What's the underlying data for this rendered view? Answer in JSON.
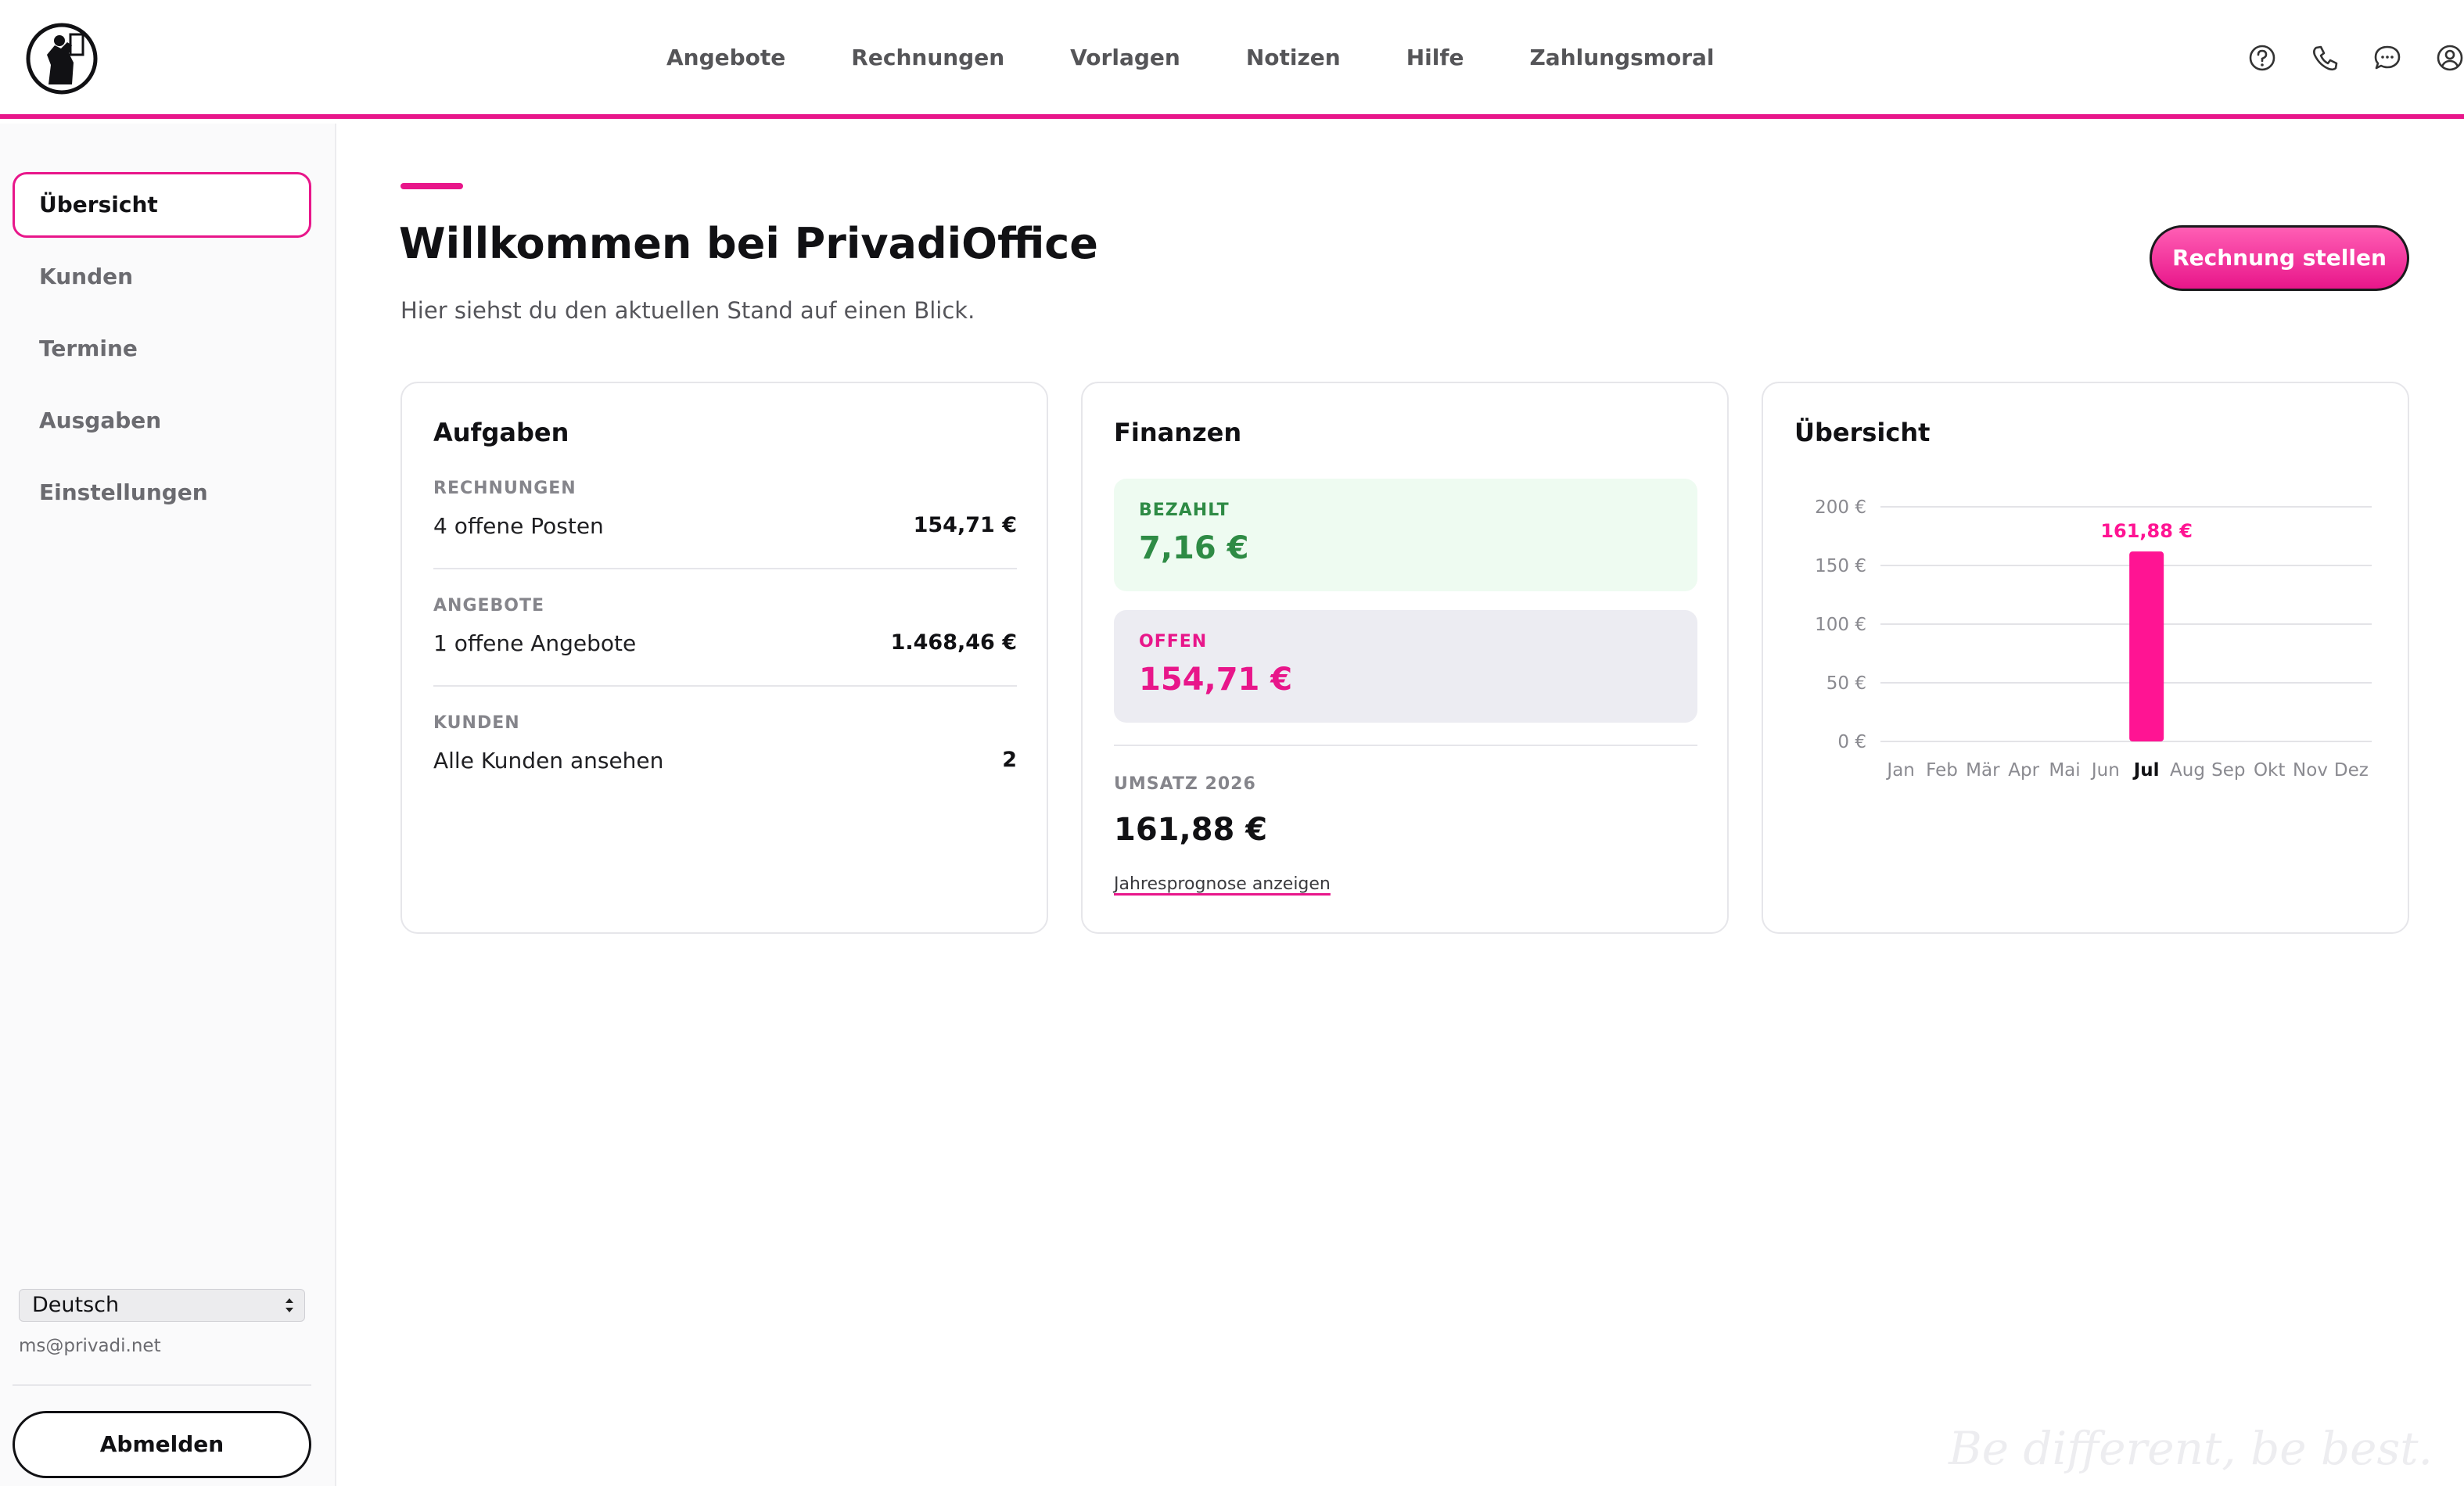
{
  "header": {
    "nav": [
      "Angebote",
      "Rechnungen",
      "Vorlagen",
      "Notizen",
      "Hilfe",
      "Zahlungsmoral"
    ],
    "icons": [
      "help-icon",
      "phone-icon",
      "chat-icon",
      "user-icon"
    ]
  },
  "sidebar": {
    "items": [
      {
        "label": "Übersicht",
        "active": true
      },
      {
        "label": "Kunden",
        "active": false
      },
      {
        "label": "Termine",
        "active": false
      },
      {
        "label": "Ausgaben",
        "active": false
      },
      {
        "label": "Einstellungen",
        "active": false
      }
    ],
    "language": "Deutsch",
    "email": "ms@privadi.net",
    "logout_label": "Abmelden"
  },
  "main": {
    "title": "Willkommen bei PrivadiOffice",
    "subtitle": "Hier siehst du den aktuellen Stand auf einen Blick.",
    "cta_label": "Rechnung stellen"
  },
  "tasks": {
    "title": "Aufgaben",
    "rows": [
      {
        "kicker": "RECHNUNGEN",
        "label": "4 offene Posten",
        "value": "154,71 €"
      },
      {
        "kicker": "ANGEBOTE",
        "label": "1 offene Angebote",
        "value": "1.468,46 €"
      },
      {
        "kicker": "KUNDEN",
        "label": "Alle Kunden ansehen",
        "value": "2"
      }
    ]
  },
  "finance": {
    "title": "Finanzen",
    "paid_label": "BEZAHLT",
    "paid_value": "7,16 €",
    "open_label": "OFFEN",
    "open_value": "154,71 €",
    "revenue_label": "UMSATZ 2026",
    "revenue_value": "161,88 €",
    "forecast_link": "Jahresprognose anzeigen"
  },
  "overview": {
    "title": "Übersicht"
  },
  "chart_data": {
    "type": "bar",
    "categories": [
      "Jan",
      "Feb",
      "Mär",
      "Apr",
      "Mai",
      "Jun",
      "Jul",
      "Aug",
      "Sep",
      "Okt",
      "Nov",
      "Dez"
    ],
    "values": [
      0,
      0,
      0,
      0,
      0,
      0,
      161.88,
      0,
      0,
      0,
      0,
      0
    ],
    "data_label": "161,88 €",
    "highlight_index": 6,
    "yticks": [
      "0 €",
      "50 €",
      "100 €",
      "150 €",
      "200 €"
    ],
    "ylim": [
      0,
      200
    ],
    "grid": true,
    "bar_color": "#ff1493"
  },
  "footer": {
    "watermark": "Be different, be best."
  },
  "colors": {
    "accent": "#e8168a",
    "paid": "#2e8b45",
    "paid_bg": "#eefbf1",
    "open_bg": "#ececf2"
  }
}
